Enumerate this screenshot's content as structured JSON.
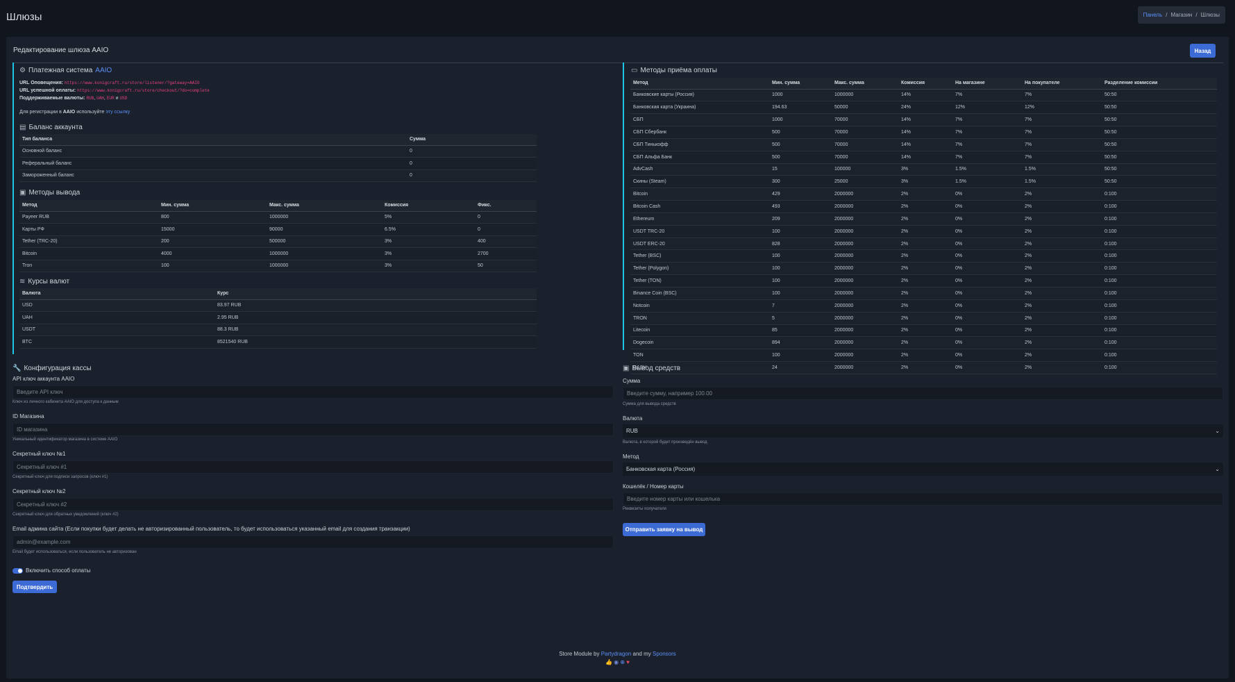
{
  "page_title": "Шлюзы",
  "breadcrumb": [
    "Панель",
    "Магазин",
    "Шлюзы"
  ],
  "card_title": "Редактирование шлюза AAIO",
  "back_label": "Назад",
  "gateway": {
    "title": "Платежная система",
    "name": "AAIO",
    "url_notify_label": "URL Оповещения:",
    "url_notify": "https://www.konigcraft.ru/store/listener/?gateway=AAIO",
    "url_success_label": "URL успешной оплаты:",
    "url_success": "https://www.konigcraft.ru/store/checkout/?do=complete",
    "currencies_label": "Поддерживаемые валюты:",
    "currencies": [
      "RUB",
      "UAH",
      "EUR",
      "USD"
    ],
    "currencies_and": "и",
    "register_prefix": "Для регистрации в",
    "register_name": "AAIO",
    "register_mid": "используйте",
    "register_link": "эту ссылку"
  },
  "balance": {
    "title": "Баланс аккаунта",
    "headers": [
      "Тип баланса",
      "Сумма"
    ],
    "rows": [
      [
        "Основной баланс",
        "0"
      ],
      [
        "Реферальный баланс",
        "0"
      ],
      [
        "Замороженный баланс",
        "0"
      ]
    ]
  },
  "withdraw_methods": {
    "title": "Методы вывода",
    "headers": [
      "Метод",
      "Мин. сумма",
      "Макс. сумма",
      "Комиссия",
      "Фикс."
    ],
    "rows": [
      [
        "Payeer RUB",
        "800",
        "1000000",
        "5%",
        "0"
      ],
      [
        "Карты РФ",
        "15000",
        "90000",
        "6.5%",
        "0"
      ],
      [
        "Tether (TRC-20)",
        "200",
        "500000",
        "3%",
        "400"
      ],
      [
        "Bitcoin",
        "4000",
        "1000000",
        "3%",
        "2700"
      ],
      [
        "Tron",
        "100",
        "1000000",
        "3%",
        "50"
      ]
    ]
  },
  "rates": {
    "title": "Курсы валют",
    "headers": [
      "Валюта",
      "Курс"
    ],
    "rows": [
      [
        "USD",
        "83.97 RUB"
      ],
      [
        "UAH",
        "2.95 RUB"
      ],
      [
        "USDT",
        "88.3 RUB"
      ],
      [
        "BTC",
        "8521540 RUB"
      ]
    ]
  },
  "payment_methods": {
    "title": "Методы приёма оплаты",
    "headers": [
      "Метод",
      "Мин. сумма",
      "Макс. сумма",
      "Комиссия",
      "На магазине",
      "На покупателе",
      "Разделение комиссии"
    ],
    "rows": [
      [
        "Банковские карты (Россия)",
        "1000",
        "1000000",
        "14%",
        "7%",
        "7%",
        "50:50"
      ],
      [
        "Банковская карта (Украина)",
        "194.63",
        "50000",
        "24%",
        "12%",
        "12%",
        "50:50"
      ],
      [
        "СБП",
        "1000",
        "70000",
        "14%",
        "7%",
        "7%",
        "50:50"
      ],
      [
        "СБП Сбербанк",
        "500",
        "70000",
        "14%",
        "7%",
        "7%",
        "50:50"
      ],
      [
        "СБП Тинькофф",
        "500",
        "70000",
        "14%",
        "7%",
        "7%",
        "50:50"
      ],
      [
        "СБП Альфа Банк",
        "500",
        "70000",
        "14%",
        "7%",
        "7%",
        "50:50"
      ],
      [
        "AdvCash",
        "15",
        "100000",
        "3%",
        "1.5%",
        "1.5%",
        "50:50"
      ],
      [
        "Скины (Steam)",
        "300",
        "25000",
        "3%",
        "1.5%",
        "1.5%",
        "50:50"
      ],
      [
        "Bitcoin",
        "429",
        "2000000",
        "2%",
        "0%",
        "2%",
        "0:100"
      ],
      [
        "Bitcoin Cash",
        "493",
        "2000000",
        "2%",
        "0%",
        "2%",
        "0:100"
      ],
      [
        "Ethereum",
        "209",
        "2000000",
        "2%",
        "0%",
        "2%",
        "0:100"
      ],
      [
        "USDT TRC-20",
        "100",
        "2000000",
        "2%",
        "0%",
        "2%",
        "0:100"
      ],
      [
        "USDT ERC-20",
        "828",
        "2000000",
        "2%",
        "0%",
        "2%",
        "0:100"
      ],
      [
        "Tether (BSC)",
        "100",
        "2000000",
        "2%",
        "0%",
        "2%",
        "0:100"
      ],
      [
        "Tether (Polygon)",
        "100",
        "2000000",
        "2%",
        "0%",
        "2%",
        "0:100"
      ],
      [
        "Tether (TON)",
        "100",
        "2000000",
        "2%",
        "0%",
        "2%",
        "0:100"
      ],
      [
        "Binance Coin (BSC)",
        "100",
        "2000000",
        "2%",
        "0%",
        "2%",
        "0:100"
      ],
      [
        "Notcoin",
        "7",
        "2000000",
        "2%",
        "0%",
        "2%",
        "0:100"
      ],
      [
        "TRON",
        "5",
        "2000000",
        "2%",
        "0%",
        "2%",
        "0:100"
      ],
      [
        "Litecoin",
        "85",
        "2000000",
        "2%",
        "0%",
        "2%",
        "0:100"
      ],
      [
        "Dogecoin",
        "894",
        "2000000",
        "2%",
        "0%",
        "2%",
        "0:100"
      ],
      [
        "TON",
        "100",
        "2000000",
        "2%",
        "0%",
        "2%",
        "0:100"
      ],
      [
        "DASH",
        "24",
        "2000000",
        "2%",
        "0%",
        "2%",
        "0:100"
      ]
    ]
  },
  "config": {
    "title": "Конфигурация кассы",
    "api_label": "API ключ аккаунта AAIO",
    "api_placeholder": "Введите API ключ",
    "api_hint": "Ключ из личного кабинета AAIO для доступа к данным",
    "shop_label": "ID Магазина",
    "shop_placeholder": "ID магазина",
    "shop_hint": "Уникальный идентификатор магазина в системе AAIO",
    "secret1_label": "Секретный ключ №1",
    "secret1_placeholder": "Секретный ключ #1",
    "secret1_hint": "Секретный ключ для подписи запросов (ключ #1)",
    "secret2_label": "Секретный ключ №2",
    "secret2_placeholder": "Секретный ключ #2",
    "secret2_hint": "Секретный ключ для обратных уведомлений (ключ #2)",
    "email_label": "Email админа сайта (Если покупки будет делать не авторизированный пользователь, то будет использоваться указанный email для создания транзакции)",
    "email_placeholder": "admin@example.com",
    "email_hint": "Email будет использоваться, если пользователь не авторизован",
    "toggle_label": "Включить способ оплаты",
    "submit_label": "Подтвердить"
  },
  "withdraw": {
    "title": "Вывод средств",
    "amount_label": "Сумма",
    "amount_placeholder": "Введите сумму, например 100.00",
    "amount_hint": "Сумма для вывода средств",
    "currency_label": "Валюта",
    "currency_value": "RUB",
    "currency_hint": "Валюта, в которой будет произведён вывод",
    "method_label": "Метод",
    "method_value": "Банковская карта (Россия)",
    "wallet_label": "Кошелёк / Номер карты",
    "wallet_placeholder": "Введите номер карты или кошелька",
    "wallet_hint": "Реквизиты получателя",
    "submit_label": "Отправить заявку на вывод"
  },
  "footer": {
    "prefix": "Store Module by",
    "author": "Partydragon",
    "mid": "and my",
    "sponsors": "Sponsors",
    "icons": [
      "thumbs-up-icon",
      "discord-icon",
      "globe-icon",
      "heart-icon"
    ]
  },
  "colors": {
    "accent": "#3d6bd6",
    "link": "#5b8ff5",
    "panel_border": "#1bc6e8",
    "code": "#e8417f"
  }
}
